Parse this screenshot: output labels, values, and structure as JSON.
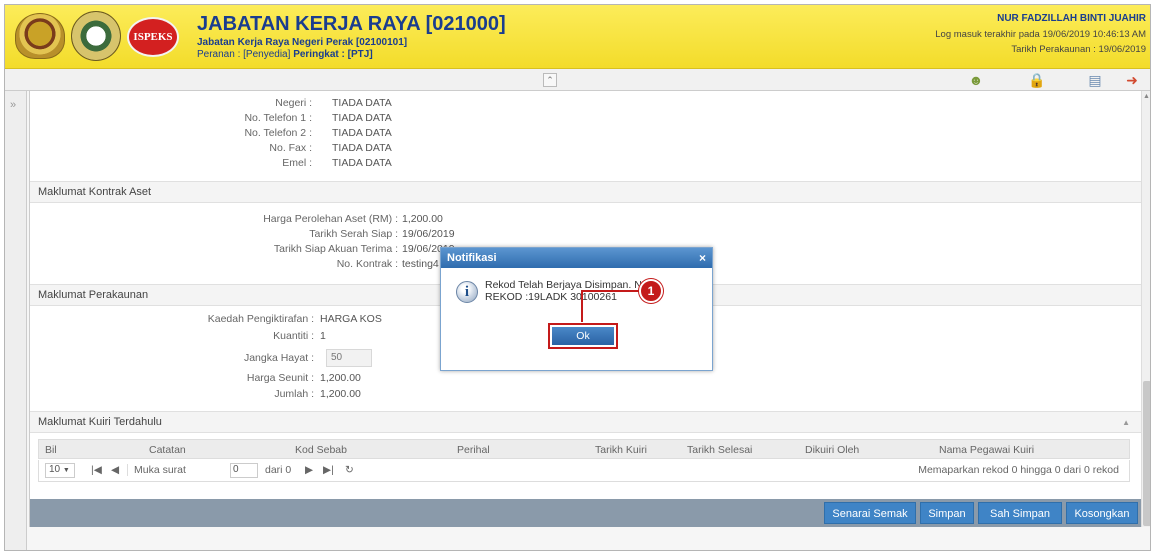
{
  "header": {
    "org_title": "JABATAN KERJA RAYA [021000]",
    "org_sub": "Jabatan Kerja Raya Negeri Perak [02100101]",
    "role_prefix": "Peranan : [Penyedia] ",
    "role_level": "Peringkat : [PTJ]",
    "logo3_text": "ISPEKS",
    "user_name": "NUR FADZILLAH BINTI JUAHIR",
    "login_info": "Log masuk terakhir pada 19/06/2019 10:46:13 AM",
    "account_date": "Tarikh Perakaunan : 19/06/2019"
  },
  "address": {
    "rows": [
      {
        "label": "Negeri :",
        "value": "TIADA DATA"
      },
      {
        "label": "No. Telefon 1 :",
        "value": "TIADA DATA"
      },
      {
        "label": "No. Telefon 2 :",
        "value": "TIADA DATA"
      },
      {
        "label": "No. Fax :",
        "value": "TIADA DATA"
      },
      {
        "label": "Emel :",
        "value": "TIADA DATA"
      }
    ]
  },
  "sections": {
    "kontrak": "Maklumat Kontrak Aset",
    "perakaunan": "Maklumat Perakaunan",
    "kuiri": "Maklumat Kuiri Terdahulu"
  },
  "kontrak": {
    "rows": [
      {
        "label": "Harga Perolehan Aset (RM) :",
        "value": "1,200.00"
      },
      {
        "label": "Tarikh Serah Siap :",
        "value": "19/06/2019"
      },
      {
        "label": "Tarikh Siap Akuan Terima :",
        "value": "19/06/2019"
      },
      {
        "label": "No. Kontrak :",
        "value": "testing4"
      }
    ]
  },
  "perakaunan": {
    "kaedah_label": "Kaedah Pengiktirafan :",
    "kaedah_value": "HARGA KOS",
    "kuantiti_label": "Kuantiti :",
    "kuantiti_value": "1",
    "jangka_label": "Jangka Hayat :",
    "jangka_value": "50",
    "seunit_label": "Harga Seunit :",
    "seunit_value": "1,200.00",
    "jumlah_label": "Jumlah :",
    "jumlah_value": "1,200.00"
  },
  "grid": {
    "columns": [
      "Bil",
      "Catatan",
      "Kod Sebab",
      "Perihal",
      "Tarikh Kuiri",
      "Tarikh Selesai",
      "Dikuiri Oleh",
      "Nama Pegawai Kuiri"
    ],
    "page_size": "10",
    "page_label": "Muka surat",
    "page_value": "0",
    "page_of": "dari 0",
    "records_info": "Memaparkan rekod 0 hingga 0 dari 0 rekod"
  },
  "actions": {
    "senarai": "Senarai Semak",
    "simpan": "Simpan",
    "sah_simpan": "Sah Simpan",
    "kosongkan": "Kosongkan"
  },
  "dialog": {
    "title": "Notifikasi",
    "close": "×",
    "message_line1": "Rekod Telah Berjaya Disimpan. NO",
    "message_line2": "REKOD :19LADK 30100261",
    "ok": "Ok"
  },
  "callout": {
    "number": "1",
    "color": "#c41a1a"
  },
  "colors": {
    "header_bg": "#f3dc2a",
    "accent": "#3f84c6",
    "title": "#1a3d8f"
  }
}
